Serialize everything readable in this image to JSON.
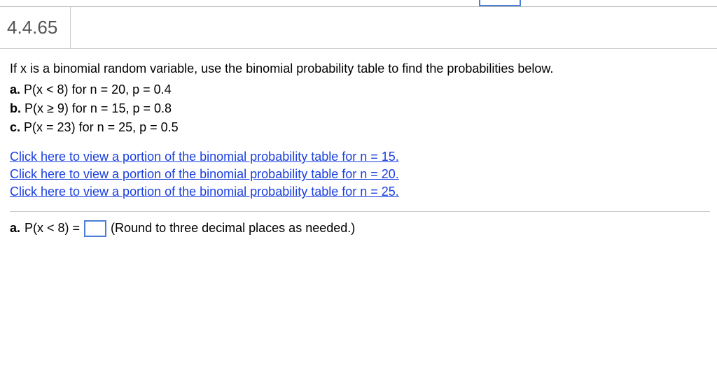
{
  "header": {
    "problem_number": "4.4.65"
  },
  "question": {
    "intro": "If x is a binomial random variable, use the binomial probability table to find the probabilities below.",
    "parts": [
      {
        "label": "a.",
        "text": "P(x < 8) for n = 20, p = 0.4"
      },
      {
        "label": "b.",
        "text": "P(x ≥ 9) for n = 15, p = 0.8"
      },
      {
        "label": "c.",
        "text": "P(x = 23) for n = 25, p = 0.5"
      }
    ]
  },
  "links": {
    "items": [
      "Click here to view a portion of the binomial probability table for n = 15.",
      "Click here to view a portion of the binomial probability table for n = 20.",
      "Click here to view a portion of the binomial probability table for n = 25."
    ]
  },
  "answer": {
    "label": "a.",
    "expr": "P(x < 8) =",
    "value": "",
    "hint": "(Round to three decimal places as needed.)"
  }
}
